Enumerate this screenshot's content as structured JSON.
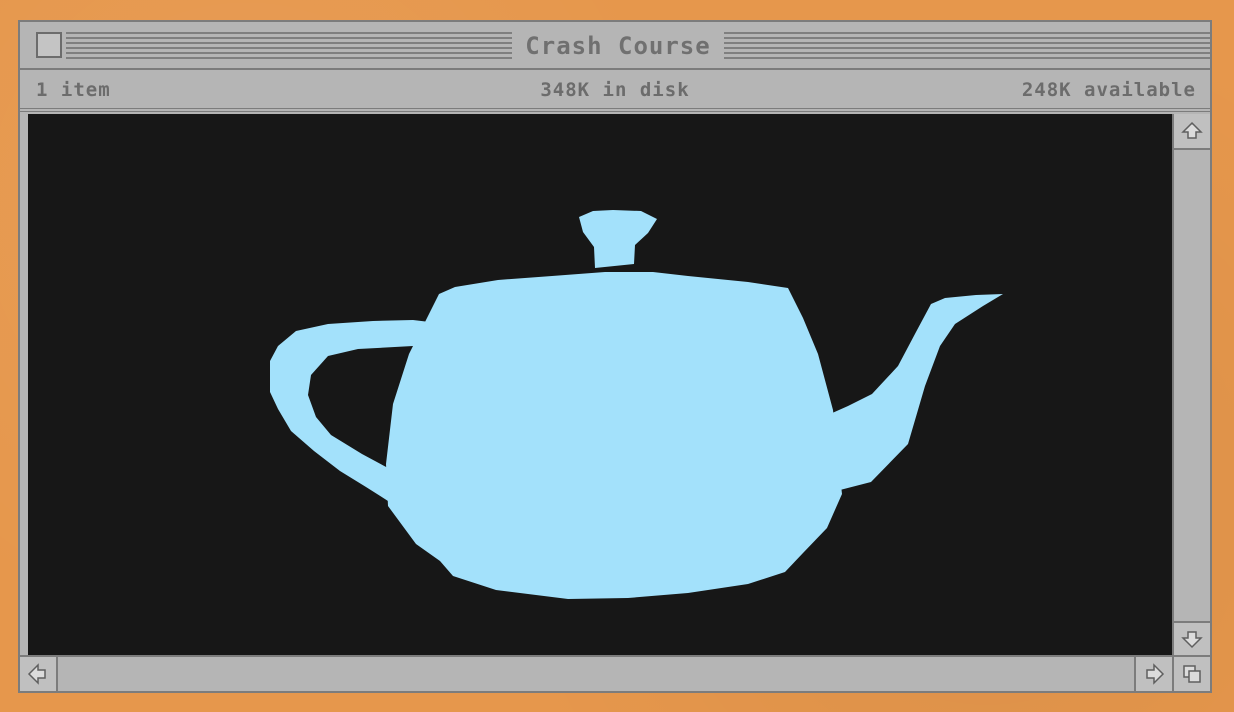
{
  "window": {
    "title": "Crash Course"
  },
  "info_bar": {
    "item_count": "1 item",
    "disk_usage": "348K in disk",
    "available": "248K available"
  },
  "content": {
    "image_subject": "utah-teapot-silhouette",
    "background_color": "#171717",
    "fill_color": "#a3e1fb"
  },
  "icons": {
    "close": "close-box-icon",
    "scroll_up": "arrow-up-icon",
    "scroll_down": "arrow-down-icon",
    "scroll_left": "arrow-left-icon",
    "scroll_right": "arrow-right-icon",
    "resize": "resize-box-icon"
  },
  "colors": {
    "desktop": "#e6974c",
    "window_chrome": "#b5b5b5",
    "text": "#6c6c6c"
  }
}
